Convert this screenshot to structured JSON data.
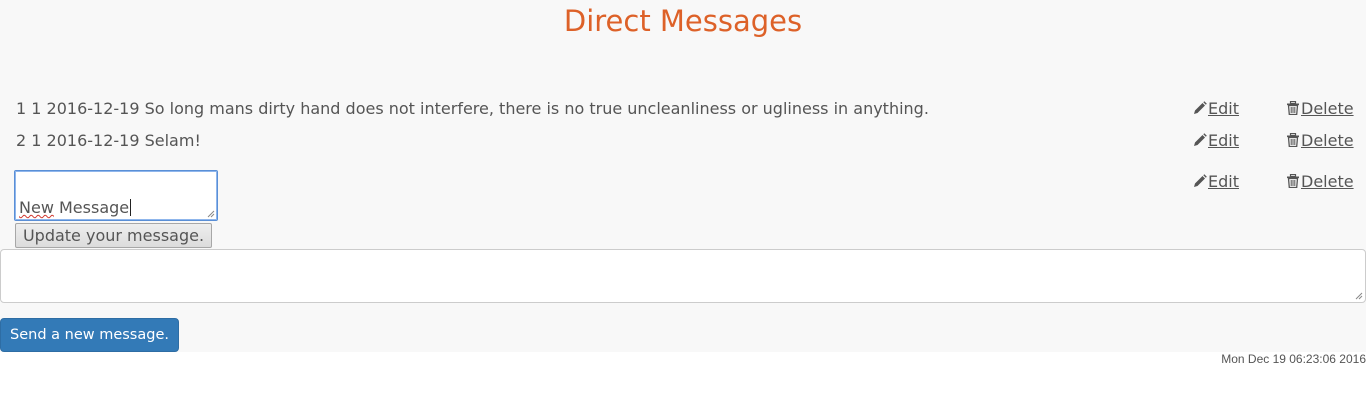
{
  "page": {
    "title": "Direct Messages",
    "footer_timestamp": "Mon Dec 19 06:23:06 2016"
  },
  "messages": [
    {
      "text": "1 1 2016-12-19 So long mans dirty hand does not interfere, there is no true uncleanliness or ugliness in anything.",
      "edit_label": "Edit",
      "delete_label": "Delete"
    },
    {
      "text": "2 1 2016-12-19 Selam!",
      "edit_label": "Edit",
      "delete_label": "Delete"
    }
  ],
  "editor": {
    "value_word1": "New",
    "value_rest": " Message",
    "update_label": "Update your message.",
    "edit_label": "Edit",
    "delete_label": "Delete"
  },
  "composer": {
    "value": "",
    "send_label": "Send a new message."
  },
  "icons": {
    "edit": "pencil-icon",
    "delete": "trash-icon"
  },
  "colors": {
    "title": "#dd6128",
    "send_button": "#337ab7",
    "text": "#555555"
  }
}
